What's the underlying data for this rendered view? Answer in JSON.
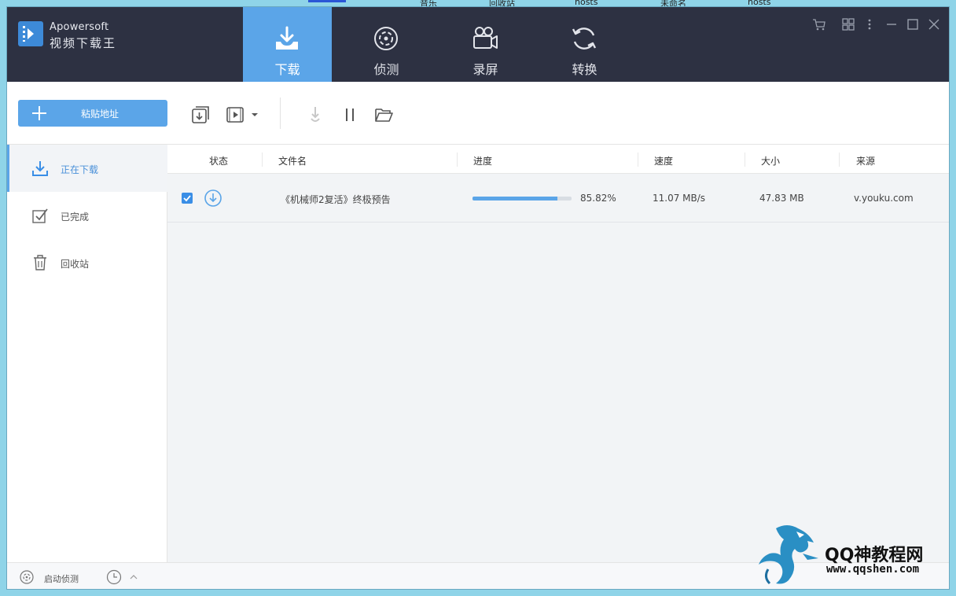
{
  "desktop": {
    "labels": [
      "音乐",
      "回收站",
      "hosts",
      "未命名",
      "hosts"
    ]
  },
  "app": {
    "brand_en": "Apowersoft",
    "brand_cn": "视频下载王"
  },
  "nav_tabs": [
    {
      "label": "下载",
      "icon": "download-tray-icon",
      "active": true
    },
    {
      "label": "侦测",
      "icon": "detect-target-icon",
      "active": false
    },
    {
      "label": "录屏",
      "icon": "video-camera-icon",
      "active": false
    },
    {
      "label": "转换",
      "icon": "convert-arrows-icon",
      "active": false
    }
  ],
  "window_controls": [
    "cart-icon",
    "grid-icon",
    "more-icon",
    "minimize-icon",
    "maximize-icon",
    "close-icon"
  ],
  "toolbar": {
    "paste_label": "粘贴地址",
    "tools": [
      "batch-download-icon",
      "video-add-icon",
      "dropdown-caret-icon",
      "start-download-icon",
      "pause-icon",
      "open-folder-icon"
    ]
  },
  "sidebar": {
    "items": [
      {
        "label": "正在下载",
        "icon": "downloading-icon",
        "active": true
      },
      {
        "label": "已完成",
        "icon": "completed-check-icon",
        "active": false
      },
      {
        "label": "回收站",
        "icon": "trash-icon",
        "active": false
      }
    ]
  },
  "table": {
    "headers": {
      "status": "状态",
      "filename": "文件名",
      "progress": "进度",
      "speed": "速度",
      "size": "大小",
      "source": "来源"
    },
    "rows": [
      {
        "checked": true,
        "status_icon": "download-circle-icon",
        "filename": "《机械师2复活》终极预告",
        "progress": 0.8582,
        "progress_text": "85.82%",
        "speed": "11.07 MB/s",
        "size": "47.83 MB",
        "source": "v.youku.com"
      }
    ]
  },
  "footer": {
    "auto_detect_label": "启动侦测",
    "icons": [
      "auto-detect-icon",
      "clock-icon",
      "chevron-up-icon"
    ]
  },
  "watermark": {
    "title": "QQ神教程网",
    "url": "www.qqshen.com"
  },
  "colors": {
    "header_bg": "#2d3142",
    "accent": "#5ba5e8",
    "desktop_bg": "#8fd4e8"
  }
}
